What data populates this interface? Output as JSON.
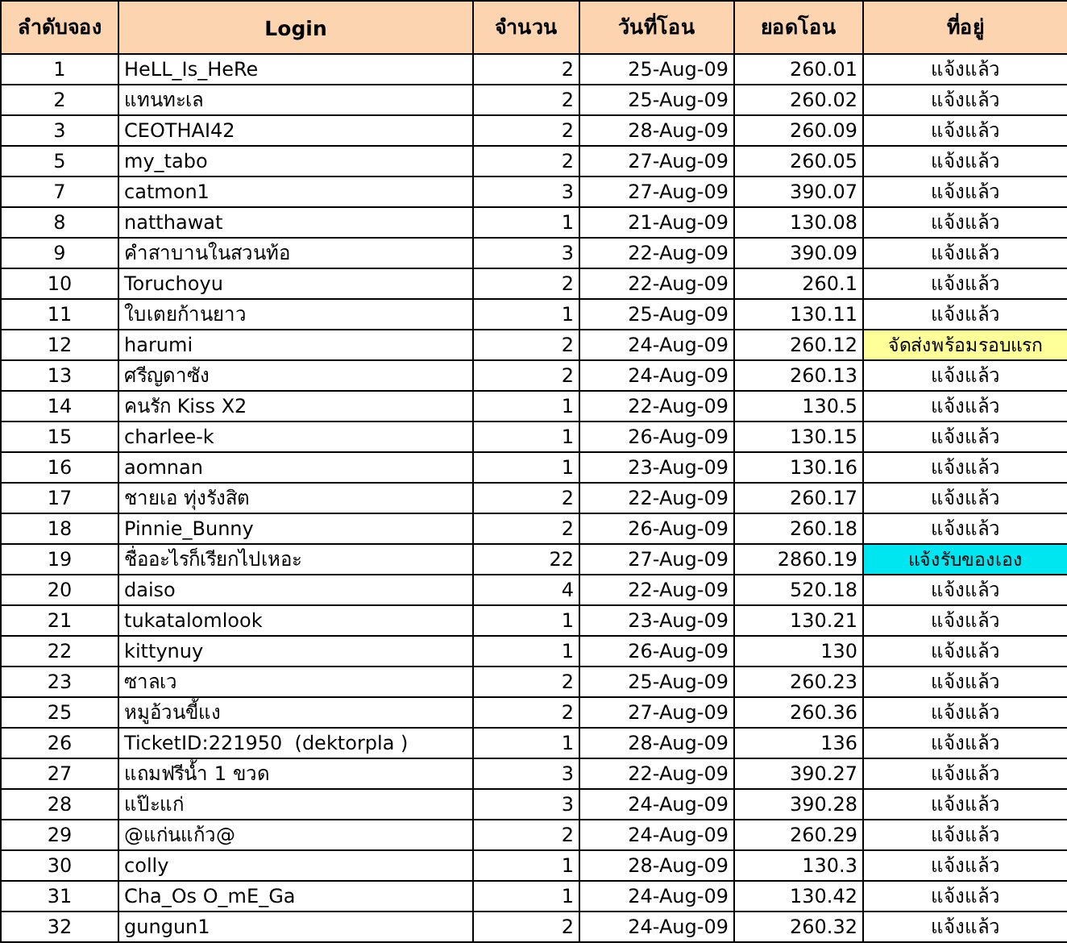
{
  "table": {
    "columns": [
      "ลำดับจอง",
      "Login",
      "จำนวน",
      "วันที่โอน",
      "ยอดโอน",
      "ที่อยู่"
    ],
    "rows": [
      {
        "no": "1",
        "login": "HeLL_Is_HeRe",
        "qty": "2",
        "date": "25-Aug-09",
        "amount": "260.01",
        "address": "แจ้งแล้ว"
      },
      {
        "no": "2",
        "login": "แทนทะเล",
        "qty": "2",
        "date": "25-Aug-09",
        "amount": "260.02",
        "address": "แจ้งแล้ว"
      },
      {
        "no": "3",
        "login": "CEOTHAI42",
        "qty": "2",
        "date": "28-Aug-09",
        "amount": "260.09",
        "address": "แจ้งแล้ว"
      },
      {
        "no": "5",
        "login": "my_tabo",
        "qty": "2",
        "date": "27-Aug-09",
        "amount": "260.05",
        "address": "แจ้งแล้ว"
      },
      {
        "no": "7",
        "login": "catmon1",
        "qty": "3",
        "date": "27-Aug-09",
        "amount": "390.07",
        "address": "แจ้งแล้ว"
      },
      {
        "no": "8",
        "login": "natthawat",
        "qty": "1",
        "date": "21-Aug-09",
        "amount": "130.08",
        "address": "แจ้งแล้ว"
      },
      {
        "no": "9",
        "login": "คำสาบานในสวนท้อ",
        "qty": "3",
        "date": "22-Aug-09",
        "amount": "390.09",
        "address": "แจ้งแล้ว"
      },
      {
        "no": "10",
        "login": "Toruchoyu",
        "qty": "2",
        "date": "22-Aug-09",
        "amount": "260.1",
        "address": "แจ้งแล้ว"
      },
      {
        "no": "11",
        "login": "ใบเตยก้านยาว",
        "qty": "1",
        "date": "25-Aug-09",
        "amount": "130.11",
        "address": "แจ้งแล้ว"
      },
      {
        "no": "12",
        "login": "harumi",
        "qty": "2",
        "date": "24-Aug-09",
        "amount": "260.12",
        "address": "จัดส่งพร้อมรอบแรก",
        "color": "#ffff99"
      },
      {
        "no": "13",
        "login": "ศรีญดาซัง",
        "qty": "2",
        "date": "24-Aug-09",
        "amount": "260.13",
        "address": "แจ้งแล้ว"
      },
      {
        "no": "14",
        "login": "คนรัก Kiss X2",
        "qty": "1",
        "date": "22-Aug-09",
        "amount": "130.5",
        "address": "แจ้งแล้ว"
      },
      {
        "no": "15",
        "login": "charlee-k",
        "qty": "1",
        "date": "26-Aug-09",
        "amount": "130.15",
        "address": "แจ้งแล้ว"
      },
      {
        "no": "16",
        "login": "aomnan",
        "qty": "1",
        "date": "23-Aug-09",
        "amount": "130.16",
        "address": "แจ้งแล้ว"
      },
      {
        "no": "17",
        "login": "ชายเอ ทุ่งรังสิต",
        "qty": "2",
        "date": "22-Aug-09",
        "amount": "260.17",
        "address": "แจ้งแล้ว"
      },
      {
        "no": "18",
        "login": "Pinnie_Bunny",
        "qty": "2",
        "date": "26-Aug-09",
        "amount": "260.18",
        "address": "แจ้งแล้ว"
      },
      {
        "no": "19",
        "login": "ชื่ออะไรก็เรียกไปเหอะ",
        "qty": "22",
        "date": "27-Aug-09",
        "amount": "2860.19",
        "address": "แจ้งรับของเอง",
        "color": "#00e6f0"
      },
      {
        "no": "20",
        "login": "daiso",
        "qty": "4",
        "date": "22-Aug-09",
        "amount": "520.18",
        "address": "แจ้งแล้ว"
      },
      {
        "no": "21",
        "login": "tukatalomlook",
        "qty": "1",
        "date": "23-Aug-09",
        "amount": "130.21",
        "address": "แจ้งแล้ว"
      },
      {
        "no": "22",
        "login": "kittynuy",
        "qty": "1",
        "date": "26-Aug-09",
        "amount": "130",
        "address": "แจ้งแล้ว"
      },
      {
        "no": "23",
        "login": "ซาลเว",
        "qty": "2",
        "date": "25-Aug-09",
        "amount": "260.23",
        "address": "แจ้งแล้ว"
      },
      {
        "no": "25",
        "login": "หมูอ้วนขี้แง",
        "qty": "2",
        "date": "27-Aug-09",
        "amount": "260.36",
        "address": "แจ้งแล้ว"
      },
      {
        "no": "26",
        "login": "TicketID:221950  (dektorpla )",
        "qty": "1",
        "date": "28-Aug-09",
        "amount": "136",
        "address": "แจ้งแล้ว"
      },
      {
        "no": "27",
        "login": "แถมฟรีน้ำ 1 ขวด",
        "qty": "3",
        "date": "22-Aug-09",
        "amount": "390.27",
        "address": "แจ้งแล้ว"
      },
      {
        "no": "28",
        "login": "แป๊ะแก่",
        "qty": "3",
        "date": "24-Aug-09",
        "amount": "390.28",
        "address": "แจ้งแล้ว"
      },
      {
        "no": "29",
        "login": "@แก่นแก้ว@",
        "qty": "2",
        "date": "24-Aug-09",
        "amount": "260.29",
        "address": "แจ้งแล้ว"
      },
      {
        "no": "30",
        "login": "colly",
        "qty": "1",
        "date": "28-Aug-09",
        "amount": "130.3",
        "address": "แจ้งแล้ว"
      },
      {
        "no": "31",
        "login": "Cha_Os O_mE_Ga",
        "qty": "1",
        "date": "24-Aug-09",
        "amount": "130.42",
        "address": "แจ้งแล้ว"
      },
      {
        "no": "32",
        "login": "gungun1",
        "qty": "2",
        "date": "24-Aug-09",
        "amount": "260.32",
        "address": "แจ้งแล้ว"
      }
    ]
  }
}
